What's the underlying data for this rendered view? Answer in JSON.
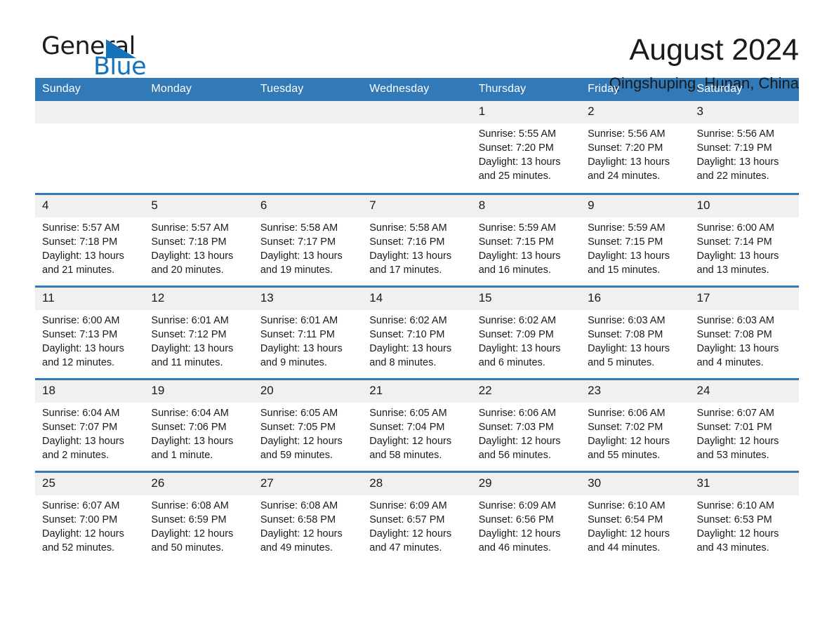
{
  "brand": {
    "name_part1": "General",
    "name_part2": "Blue",
    "accent_color": "#1573bb"
  },
  "header": {
    "title": "August 2024",
    "location": "Qingshuping, Hunan, China"
  },
  "calendar": {
    "header_bg": "#3279b7",
    "daynum_bg": "#f0f0f0",
    "weekdays": [
      "Sunday",
      "Monday",
      "Tuesday",
      "Wednesday",
      "Thursday",
      "Friday",
      "Saturday"
    ],
    "weeks": [
      [
        {
          "day": "",
          "sunrise": "",
          "sunset": "",
          "daylight1": "",
          "daylight2": ""
        },
        {
          "day": "",
          "sunrise": "",
          "sunset": "",
          "daylight1": "",
          "daylight2": ""
        },
        {
          "day": "",
          "sunrise": "",
          "sunset": "",
          "daylight1": "",
          "daylight2": ""
        },
        {
          "day": "",
          "sunrise": "",
          "sunset": "",
          "daylight1": "",
          "daylight2": ""
        },
        {
          "day": "1",
          "sunrise": "Sunrise: 5:55 AM",
          "sunset": "Sunset: 7:20 PM",
          "daylight1": "Daylight: 13 hours",
          "daylight2": "and 25 minutes."
        },
        {
          "day": "2",
          "sunrise": "Sunrise: 5:56 AM",
          "sunset": "Sunset: 7:20 PM",
          "daylight1": "Daylight: 13 hours",
          "daylight2": "and 24 minutes."
        },
        {
          "day": "3",
          "sunrise": "Sunrise: 5:56 AM",
          "sunset": "Sunset: 7:19 PM",
          "daylight1": "Daylight: 13 hours",
          "daylight2": "and 22 minutes."
        }
      ],
      [
        {
          "day": "4",
          "sunrise": "Sunrise: 5:57 AM",
          "sunset": "Sunset: 7:18 PM",
          "daylight1": "Daylight: 13 hours",
          "daylight2": "and 21 minutes."
        },
        {
          "day": "5",
          "sunrise": "Sunrise: 5:57 AM",
          "sunset": "Sunset: 7:18 PM",
          "daylight1": "Daylight: 13 hours",
          "daylight2": "and 20 minutes."
        },
        {
          "day": "6",
          "sunrise": "Sunrise: 5:58 AM",
          "sunset": "Sunset: 7:17 PM",
          "daylight1": "Daylight: 13 hours",
          "daylight2": "and 19 minutes."
        },
        {
          "day": "7",
          "sunrise": "Sunrise: 5:58 AM",
          "sunset": "Sunset: 7:16 PM",
          "daylight1": "Daylight: 13 hours",
          "daylight2": "and 17 minutes."
        },
        {
          "day": "8",
          "sunrise": "Sunrise: 5:59 AM",
          "sunset": "Sunset: 7:15 PM",
          "daylight1": "Daylight: 13 hours",
          "daylight2": "and 16 minutes."
        },
        {
          "day": "9",
          "sunrise": "Sunrise: 5:59 AM",
          "sunset": "Sunset: 7:15 PM",
          "daylight1": "Daylight: 13 hours",
          "daylight2": "and 15 minutes."
        },
        {
          "day": "10",
          "sunrise": "Sunrise: 6:00 AM",
          "sunset": "Sunset: 7:14 PM",
          "daylight1": "Daylight: 13 hours",
          "daylight2": "and 13 minutes."
        }
      ],
      [
        {
          "day": "11",
          "sunrise": "Sunrise: 6:00 AM",
          "sunset": "Sunset: 7:13 PM",
          "daylight1": "Daylight: 13 hours",
          "daylight2": "and 12 minutes."
        },
        {
          "day": "12",
          "sunrise": "Sunrise: 6:01 AM",
          "sunset": "Sunset: 7:12 PM",
          "daylight1": "Daylight: 13 hours",
          "daylight2": "and 11 minutes."
        },
        {
          "day": "13",
          "sunrise": "Sunrise: 6:01 AM",
          "sunset": "Sunset: 7:11 PM",
          "daylight1": "Daylight: 13 hours",
          "daylight2": "and 9 minutes."
        },
        {
          "day": "14",
          "sunrise": "Sunrise: 6:02 AM",
          "sunset": "Sunset: 7:10 PM",
          "daylight1": "Daylight: 13 hours",
          "daylight2": "and 8 minutes."
        },
        {
          "day": "15",
          "sunrise": "Sunrise: 6:02 AM",
          "sunset": "Sunset: 7:09 PM",
          "daylight1": "Daylight: 13 hours",
          "daylight2": "and 6 minutes."
        },
        {
          "day": "16",
          "sunrise": "Sunrise: 6:03 AM",
          "sunset": "Sunset: 7:08 PM",
          "daylight1": "Daylight: 13 hours",
          "daylight2": "and 5 minutes."
        },
        {
          "day": "17",
          "sunrise": "Sunrise: 6:03 AM",
          "sunset": "Sunset: 7:08 PM",
          "daylight1": "Daylight: 13 hours",
          "daylight2": "and 4 minutes."
        }
      ],
      [
        {
          "day": "18",
          "sunrise": "Sunrise: 6:04 AM",
          "sunset": "Sunset: 7:07 PM",
          "daylight1": "Daylight: 13 hours",
          "daylight2": "and 2 minutes."
        },
        {
          "day": "19",
          "sunrise": "Sunrise: 6:04 AM",
          "sunset": "Sunset: 7:06 PM",
          "daylight1": "Daylight: 13 hours",
          "daylight2": "and 1 minute."
        },
        {
          "day": "20",
          "sunrise": "Sunrise: 6:05 AM",
          "sunset": "Sunset: 7:05 PM",
          "daylight1": "Daylight: 12 hours",
          "daylight2": "and 59 minutes."
        },
        {
          "day": "21",
          "sunrise": "Sunrise: 6:05 AM",
          "sunset": "Sunset: 7:04 PM",
          "daylight1": "Daylight: 12 hours",
          "daylight2": "and 58 minutes."
        },
        {
          "day": "22",
          "sunrise": "Sunrise: 6:06 AM",
          "sunset": "Sunset: 7:03 PM",
          "daylight1": "Daylight: 12 hours",
          "daylight2": "and 56 minutes."
        },
        {
          "day": "23",
          "sunrise": "Sunrise: 6:06 AM",
          "sunset": "Sunset: 7:02 PM",
          "daylight1": "Daylight: 12 hours",
          "daylight2": "and 55 minutes."
        },
        {
          "day": "24",
          "sunrise": "Sunrise: 6:07 AM",
          "sunset": "Sunset: 7:01 PM",
          "daylight1": "Daylight: 12 hours",
          "daylight2": "and 53 minutes."
        }
      ],
      [
        {
          "day": "25",
          "sunrise": "Sunrise: 6:07 AM",
          "sunset": "Sunset: 7:00 PM",
          "daylight1": "Daylight: 12 hours",
          "daylight2": "and 52 minutes."
        },
        {
          "day": "26",
          "sunrise": "Sunrise: 6:08 AM",
          "sunset": "Sunset: 6:59 PM",
          "daylight1": "Daylight: 12 hours",
          "daylight2": "and 50 minutes."
        },
        {
          "day": "27",
          "sunrise": "Sunrise: 6:08 AM",
          "sunset": "Sunset: 6:58 PM",
          "daylight1": "Daylight: 12 hours",
          "daylight2": "and 49 minutes."
        },
        {
          "day": "28",
          "sunrise": "Sunrise: 6:09 AM",
          "sunset": "Sunset: 6:57 PM",
          "daylight1": "Daylight: 12 hours",
          "daylight2": "and 47 minutes."
        },
        {
          "day": "29",
          "sunrise": "Sunrise: 6:09 AM",
          "sunset": "Sunset: 6:56 PM",
          "daylight1": "Daylight: 12 hours",
          "daylight2": "and 46 minutes."
        },
        {
          "day": "30",
          "sunrise": "Sunrise: 6:10 AM",
          "sunset": "Sunset: 6:54 PM",
          "daylight1": "Daylight: 12 hours",
          "daylight2": "and 44 minutes."
        },
        {
          "day": "31",
          "sunrise": "Sunrise: 6:10 AM",
          "sunset": "Sunset: 6:53 PM",
          "daylight1": "Daylight: 12 hours",
          "daylight2": "and 43 minutes."
        }
      ]
    ]
  }
}
